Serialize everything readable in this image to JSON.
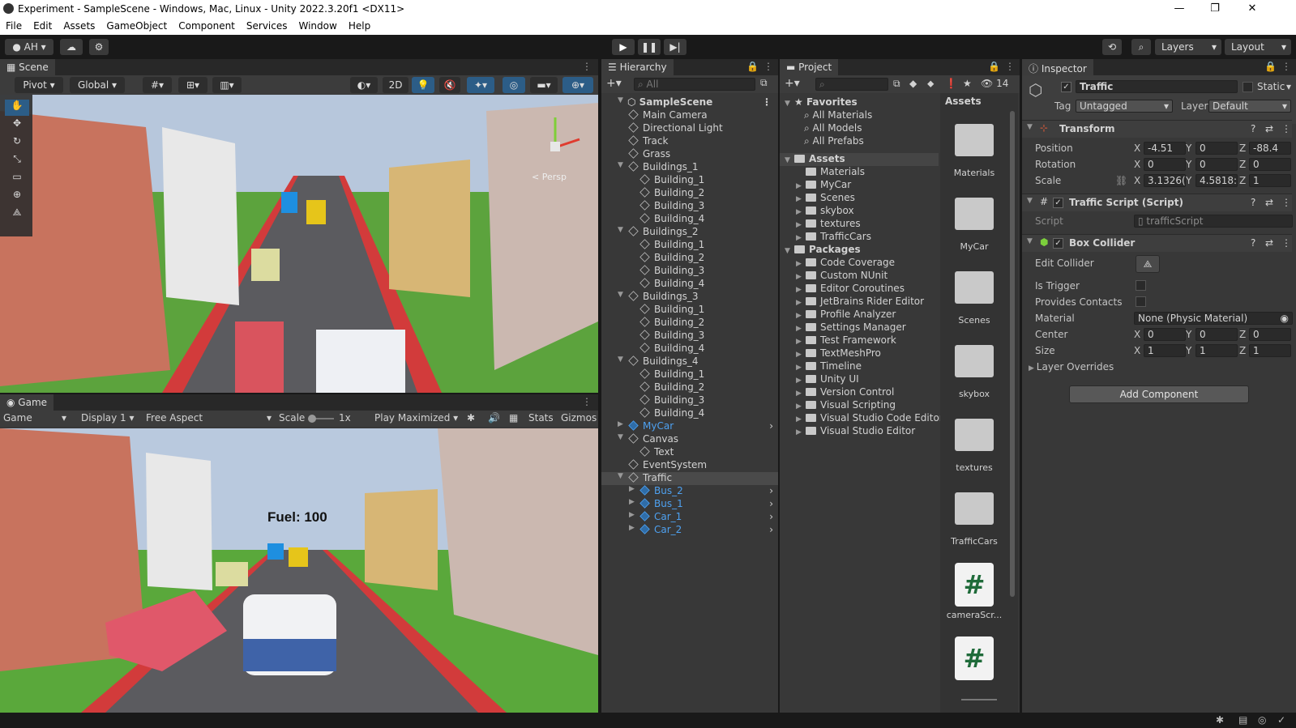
{
  "window": {
    "title": "Experiment - SampleScene - Windows, Mac, Linux - Unity 2022.3.20f1 <DX11>",
    "minimize": "—",
    "maximize": "❐",
    "close": "✕"
  },
  "menu": [
    "File",
    "Edit",
    "Assets",
    "GameObject",
    "Component",
    "Services",
    "Window",
    "Help"
  ],
  "toolbar": {
    "account": "AH",
    "layers": "Layers",
    "layout": "Layout"
  },
  "scene": {
    "tab": "Scene",
    "pivot": "Pivot",
    "global": "Global",
    "twod": "2D",
    "persp": "< Persp"
  },
  "game": {
    "tab": "Game",
    "mode": "Game",
    "display": "Display 1",
    "aspect": "Free Aspect",
    "scale_label": "Scale",
    "scale_value": "1x",
    "play": "Play Maximized",
    "stats": "Stats",
    "gizmos": "Gizmos",
    "fuel": "Fuel: 100"
  },
  "hierarchy": {
    "tab": "Hierarchy",
    "search_placeholder": "All",
    "scene_name": "SampleScene",
    "items": [
      {
        "label": "Main Camera",
        "indent": 1
      },
      {
        "label": "Directional Light",
        "indent": 1
      },
      {
        "label": "Track",
        "indent": 1
      },
      {
        "label": "Grass",
        "indent": 1
      },
      {
        "label": "Buildings_1",
        "indent": 1,
        "open": true
      },
      {
        "label": "Building_1",
        "indent": 2
      },
      {
        "label": "Building_2",
        "indent": 2
      },
      {
        "label": "Building_3",
        "indent": 2
      },
      {
        "label": "Building_4",
        "indent": 2
      },
      {
        "label": "Buildings_2",
        "indent": 1,
        "open": true
      },
      {
        "label": "Building_1",
        "indent": 2
      },
      {
        "label": "Building_2",
        "indent": 2
      },
      {
        "label": "Building_3",
        "indent": 2
      },
      {
        "label": "Building_4",
        "indent": 2
      },
      {
        "label": "Buildings_3",
        "indent": 1,
        "open": true
      },
      {
        "label": "Building_1",
        "indent": 2
      },
      {
        "label": "Building_2",
        "indent": 2
      },
      {
        "label": "Building_3",
        "indent": 2
      },
      {
        "label": "Building_4",
        "indent": 2
      },
      {
        "label": "Buildings_4",
        "indent": 1,
        "open": true
      },
      {
        "label": "Building_1",
        "indent": 2
      },
      {
        "label": "Building_2",
        "indent": 2
      },
      {
        "label": "Building_3",
        "indent": 2
      },
      {
        "label": "Building_4",
        "indent": 2
      },
      {
        "label": "MyCar",
        "indent": 1,
        "prefab": true,
        "closed": true
      },
      {
        "label": "Canvas",
        "indent": 1,
        "open": true
      },
      {
        "label": "Text",
        "indent": 2
      },
      {
        "label": "EventSystem",
        "indent": 1
      },
      {
        "label": "Traffic",
        "indent": 1,
        "open": true,
        "selected": true
      },
      {
        "label": "Bus_2",
        "indent": 2,
        "prefab": true,
        "closed": true
      },
      {
        "label": "Bus_1",
        "indent": 2,
        "prefab": true,
        "closed": true
      },
      {
        "label": "Car_1",
        "indent": 2,
        "prefab": true,
        "closed": true
      },
      {
        "label": "Car_2",
        "indent": 2,
        "prefab": true,
        "closed": true
      }
    ]
  },
  "project": {
    "tab": "Project",
    "hidden_count": "14",
    "favorites": "Favorites",
    "fav_items": [
      "All Materials",
      "All Models",
      "All Prefabs"
    ],
    "assets_label": "Assets",
    "asset_folders": [
      "Materials",
      "MyCar",
      "Scenes",
      "skybox",
      "textures",
      "TrafficCars"
    ],
    "packages_label": "Packages",
    "packages": [
      "Code Coverage",
      "Custom NUnit",
      "Editor Coroutines",
      "JetBrains Rider Editor",
      "Profile Analyzer",
      "Settings Manager",
      "Test Framework",
      "TextMeshPro",
      "Timeline",
      "Unity UI",
      "Version Control",
      "Visual Scripting",
      "Visual Studio Code Editor",
      "Visual Studio Editor"
    ],
    "grid_header": "Assets",
    "grid": [
      {
        "name": "Materials",
        "kind": "folder"
      },
      {
        "name": "MyCar",
        "kind": "folder"
      },
      {
        "name": "Scenes",
        "kind": "folder"
      },
      {
        "name": "skybox",
        "kind": "folder"
      },
      {
        "name": "textures",
        "kind": "folder"
      },
      {
        "name": "TrafficCars",
        "kind": "folder"
      },
      {
        "name": "cameraScr...",
        "kind": "script"
      },
      {
        "name": "",
        "kind": "script"
      }
    ]
  },
  "inspector": {
    "tab": "Inspector",
    "object_name": "Traffic",
    "static": "Static",
    "tag_label": "Tag",
    "tag": "Untagged",
    "layer_label": "Layer",
    "layer": "Default",
    "transform": {
      "title": "Transform",
      "position_label": "Position",
      "rotation_label": "Rotation",
      "scale_label": "Scale",
      "position": [
        "-4.51",
        "0",
        "-88.4"
      ],
      "rotation": [
        "0",
        "0",
        "0"
      ],
      "scale": [
        "3.1326(",
        "4.5818:",
        "1"
      ]
    },
    "traffic_script": {
      "title": "Traffic Script (Script)",
      "script_label": "Script",
      "script": "trafficScript"
    },
    "box_collider": {
      "title": "Box Collider",
      "edit_label": "Edit Collider",
      "trigger_label": "Is Trigger",
      "contacts_label": "Provides Contacts",
      "material_label": "Material",
      "material": "None (Physic Material)",
      "center_label": "Center",
      "size_label": "Size",
      "center": [
        "0",
        "0",
        "0"
      ],
      "size": [
        "1",
        "1",
        "1"
      ],
      "overrides": "Layer Overrides"
    },
    "add_component": "Add Component"
  },
  "axis": {
    "x": "X",
    "y": "Y",
    "z": "Z"
  },
  "colors": {
    "accent": "#2c5d87",
    "prefab": "#4ea1f0",
    "panel": "#383838",
    "dark": "#191919"
  }
}
